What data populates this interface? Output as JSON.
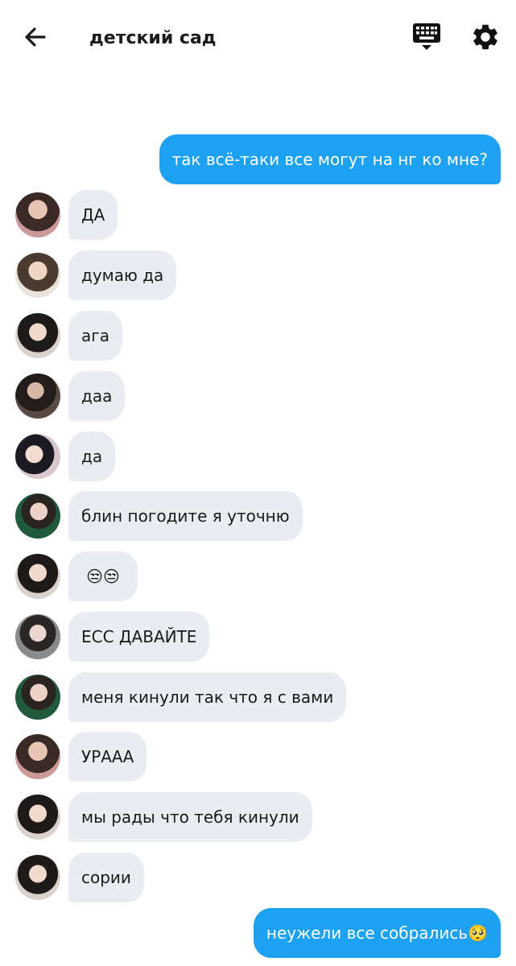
{
  "header": {
    "title": "детский сад",
    "back_icon": "arrow-left-icon",
    "keyboard_icon": "keyboard-hide-icon",
    "settings_icon": "gear-icon"
  },
  "colors": {
    "outgoing_bubble": "#1da1f2",
    "incoming_bubble": "#e9edf1"
  },
  "messages": [
    {
      "direction": "out",
      "text": "так всё-таки все могут на нг ко мне?"
    },
    {
      "direction": "in",
      "text": "ДА"
    },
    {
      "direction": "in",
      "text": "думаю да"
    },
    {
      "direction": "in",
      "text": "ага"
    },
    {
      "direction": "in",
      "text": "даа"
    },
    {
      "direction": "in",
      "text": "да"
    },
    {
      "direction": "in",
      "text": "блин погодите я уточню"
    },
    {
      "direction": "in",
      "text": "😒😒"
    },
    {
      "direction": "in",
      "text": "ЕСС ДАВАЙТЕ"
    },
    {
      "direction": "in",
      "text": "меня кинули так что я с вами"
    },
    {
      "direction": "in",
      "text": "УРААА"
    },
    {
      "direction": "in",
      "text": "мы рады что тебя кинули"
    },
    {
      "direction": "in",
      "text": "сории"
    },
    {
      "direction": "out",
      "text": "неужели все собрались🥺"
    }
  ]
}
